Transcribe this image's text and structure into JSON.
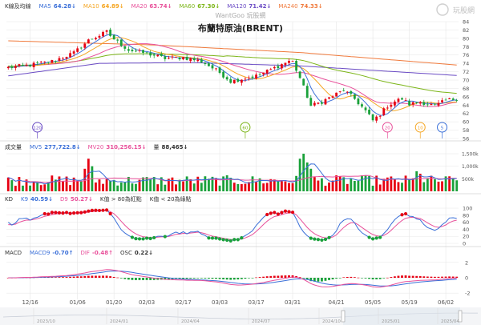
{
  "watermark": "WantGoo 玩股網",
  "logo_text": "玩股網",
  "title": "布蘭特原油(BRENT)",
  "colors": {
    "k_up": "#e60012",
    "k_down": "#1aa13a",
    "ma5": "#3a6fd8",
    "ma10": "#f5a623",
    "ma20": "#e8509a",
    "ma60": "#7cb518",
    "ma120": "#6a4bc4",
    "ma240": "#f07a3c",
    "vol_up": "#e60012",
    "vol_down": "#1aa13a",
    "vma5": "#3a6fd8",
    "vma20": "#e8509a",
    "k9": "#3a6fd8",
    "d9": "#e8509a",
    "macd9": "#3a6fd8",
    "dif": "#e8509a",
    "grid": "#e6e6e6",
    "axis_text": "#555555"
  },
  "legend_price": [
    {
      "key": "k",
      "label": "K線及均線",
      "color": "#333333"
    },
    {
      "key": "ma5",
      "label": "MA5",
      "value": "64.28↓",
      "color": "#3a6fd8"
    },
    {
      "key": "ma10",
      "label": "MA10",
      "value": "64.89↓",
      "color": "#f5a623"
    },
    {
      "key": "ma20",
      "label": "MA20",
      "value": "63.74↓",
      "color": "#e8509a"
    },
    {
      "key": "ma60",
      "label": "MA60",
      "value": "67.30↓",
      "color": "#7cb518"
    },
    {
      "key": "ma120",
      "label": "MA120",
      "value": "71.42↓",
      "color": "#6a4bc4"
    },
    {
      "key": "ma240",
      "label": "MA240",
      "value": "74.33↓",
      "color": "#f07a3c"
    }
  ],
  "legend_volume": [
    {
      "key": "vol",
      "label": "成交量",
      "color": "#333333"
    },
    {
      "key": "vma5",
      "label": "MV5",
      "value": "277,722.8↓",
      "color": "#3a6fd8"
    },
    {
      "key": "vma20",
      "label": "MV20",
      "value": "310,256.15↓",
      "color": "#e8509a"
    },
    {
      "key": "qty",
      "label": "量",
      "value": "88,465↓",
      "color": "#333333"
    }
  ],
  "legend_kd": [
    {
      "key": "kd",
      "label": "KD",
      "color": "#333333"
    },
    {
      "key": "k9",
      "label": "K9",
      "value": "40.59↓",
      "color": "#3a6fd8"
    },
    {
      "key": "d9",
      "label": "D9",
      "value": "50.27↓",
      "color": "#e8509a"
    },
    {
      "key": "note1",
      "label": "K值 > 80為紅點",
      "color": "#333333"
    },
    {
      "key": "note2",
      "label": "K值 < 20為綠點",
      "color": "#333333"
    }
  ],
  "legend_macd": [
    {
      "key": "macd",
      "label": "MACD",
      "color": "#333333"
    },
    {
      "key": "macd9",
      "label": "MACD9",
      "value": "-0.70↑",
      "color": "#3a6fd8"
    },
    {
      "key": "dif",
      "label": "DIF",
      "value": "-0.48↑",
      "color": "#e8509a"
    },
    {
      "key": "osc",
      "label": "OSC",
      "value": "0.22↓",
      "color": "#333333"
    }
  ],
  "chart_data": {
    "type": "candlestick",
    "title": "布蘭特原油(BRENT)",
    "price_axis": {
      "range": [
        56,
        84
      ],
      "ticks": [
        "84",
        "82",
        "80",
        "78",
        "76",
        "74",
        "72",
        "70",
        "68",
        "66",
        "64",
        "62",
        "60",
        "58",
        "56"
      ]
    },
    "volume_axis": {
      "ticks": [
        "1,500k",
        "1,000k",
        "500k"
      ],
      "max": 1500
    },
    "kd_axis": {
      "ticks": [
        "100",
        "80",
        "60",
        "40",
        "20",
        "0"
      ]
    },
    "macd_axis": {
      "ticks": [
        "2",
        "0",
        "-2"
      ],
      "range": [
        -2.4,
        2.4
      ]
    },
    "date_ticks": [
      {
        "index": 6,
        "label": "12/16"
      },
      {
        "index": 19,
        "label": "01/06"
      },
      {
        "index": 29,
        "label": "01/20"
      },
      {
        "index": 38,
        "label": "02/03"
      },
      {
        "index": 48,
        "label": "02/17"
      },
      {
        "index": 58,
        "label": "03/03"
      },
      {
        "index": 68,
        "label": "03/17"
      },
      {
        "index": 78,
        "label": "03/31"
      },
      {
        "index": 90,
        "label": "04/21"
      },
      {
        "index": 100,
        "label": "05/05"
      },
      {
        "index": 110,
        "label": "05/19"
      },
      {
        "index": 120,
        "label": "06/02"
      }
    ],
    "navigator_labels": [
      "2023/10",
      "2024/01",
      "2024/04",
      "2024/07",
      "2024/10",
      "2025/01",
      "2025/04"
    ],
    "event_markers": [
      {
        "index": 8,
        "label": "120",
        "color": "#6a4bc4"
      },
      {
        "index": 65,
        "label": "60",
        "color": "#7cb518"
      },
      {
        "index": 104,
        "label": "20",
        "color": "#e8509a"
      },
      {
        "index": 113,
        "label": "10",
        "color": "#f5a623"
      },
      {
        "index": 119,
        "label": "5",
        "color": "#3a6fd8"
      }
    ],
    "anchors_close": [
      [
        0,
        73.0
      ],
      [
        6,
        73.6
      ],
      [
        12,
        74.5
      ],
      [
        18,
        76.5
      ],
      [
        22,
        79.5
      ],
      [
        27,
        81.5
      ],
      [
        29,
        79.8
      ],
      [
        33,
        77.2
      ],
      [
        38,
        76.4
      ],
      [
        43,
        75.2
      ],
      [
        48,
        75.4
      ],
      [
        53,
        74.5
      ],
      [
        58,
        71.8
      ],
      [
        61,
        69.7
      ],
      [
        65,
        70.5
      ],
      [
        68,
        71.0
      ],
      [
        72,
        72.5
      ],
      [
        77,
        74.6
      ],
      [
        78,
        74.4
      ],
      [
        80,
        70.5
      ],
      [
        83,
        63.8
      ],
      [
        86,
        64.8
      ],
      [
        89,
        66.2
      ],
      [
        92,
        67.6
      ],
      [
        95,
        65.5
      ],
      [
        98,
        62.6
      ],
      [
        100,
        60.3
      ],
      [
        102,
        61.8
      ],
      [
        104,
        63.8
      ],
      [
        106,
        64.9
      ],
      [
        108,
        65.5
      ],
      [
        110,
        64.2
      ],
      [
        113,
        64.8
      ],
      [
        117,
        63.8
      ],
      [
        120,
        65.1
      ],
      [
        123,
        65.6
      ]
    ],
    "ma120_anchors": [
      [
        0,
        71.0
      ],
      [
        25,
        74.0
      ],
      [
        50,
        74.2
      ],
      [
        80,
        73.4
      ],
      [
        123,
        71.1
      ]
    ],
    "ma240_anchors": [
      [
        0,
        79.4
      ],
      [
        40,
        78.4
      ],
      [
        80,
        76.6
      ],
      [
        123,
        73.6
      ]
    ],
    "volume_bursts": [
      [
        21,
        900
      ],
      [
        22,
        1300
      ],
      [
        23,
        1000
      ],
      [
        80,
        1300
      ],
      [
        81,
        1500
      ],
      [
        82,
        1150
      ],
      [
        83,
        900
      ],
      [
        112,
        800
      ],
      [
        113,
        700
      ]
    ]
  }
}
